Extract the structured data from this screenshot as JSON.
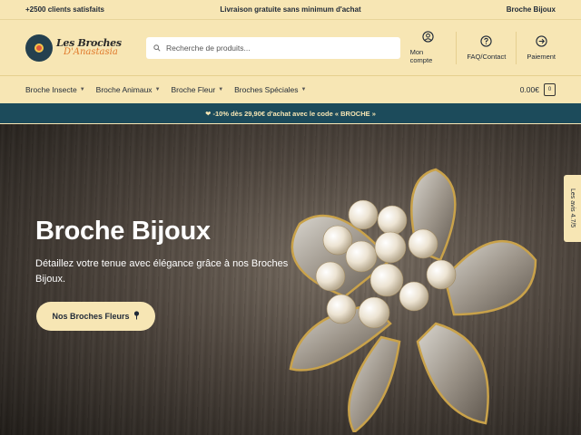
{
  "topbar": {
    "left": "+2500 clients satisfaits",
    "center": "Livraison gratuite sans minimum d'achat",
    "right": "Broche Bijoux"
  },
  "brand": {
    "line1": "Les Broches",
    "line2": "D'Anastasia"
  },
  "search": {
    "placeholder": "Recherche de produits..."
  },
  "header_actions": [
    {
      "label": "Mon compte",
      "icon": "user-circle-icon"
    },
    {
      "label": "FAQ/Contact",
      "icon": "question-circle-icon"
    },
    {
      "label": "Paiement",
      "icon": "arrow-circle-icon"
    }
  ],
  "nav": {
    "items": [
      "Broche Insecte",
      "Broche Animaux",
      "Broche Fleur",
      "Broches Spéciales"
    ],
    "cart_total": "0.00€",
    "cart_count": "0"
  },
  "promo": {
    "text": "❤ -10% dès 29,90€ d'achat avec le code « BROCHE »"
  },
  "hero": {
    "title": "Broche Bijoux",
    "subtitle": "Détaillez votre tenue avec élégance grâce à nos Broches Bijoux.",
    "cta": "Nos Broches Fleurs"
  },
  "reviews_tab": {
    "label": "Les avis 4.7/5"
  },
  "colors": {
    "cream": "#f7e6b4",
    "teal": "#1c4b5b",
    "dark": "#1f2937"
  }
}
